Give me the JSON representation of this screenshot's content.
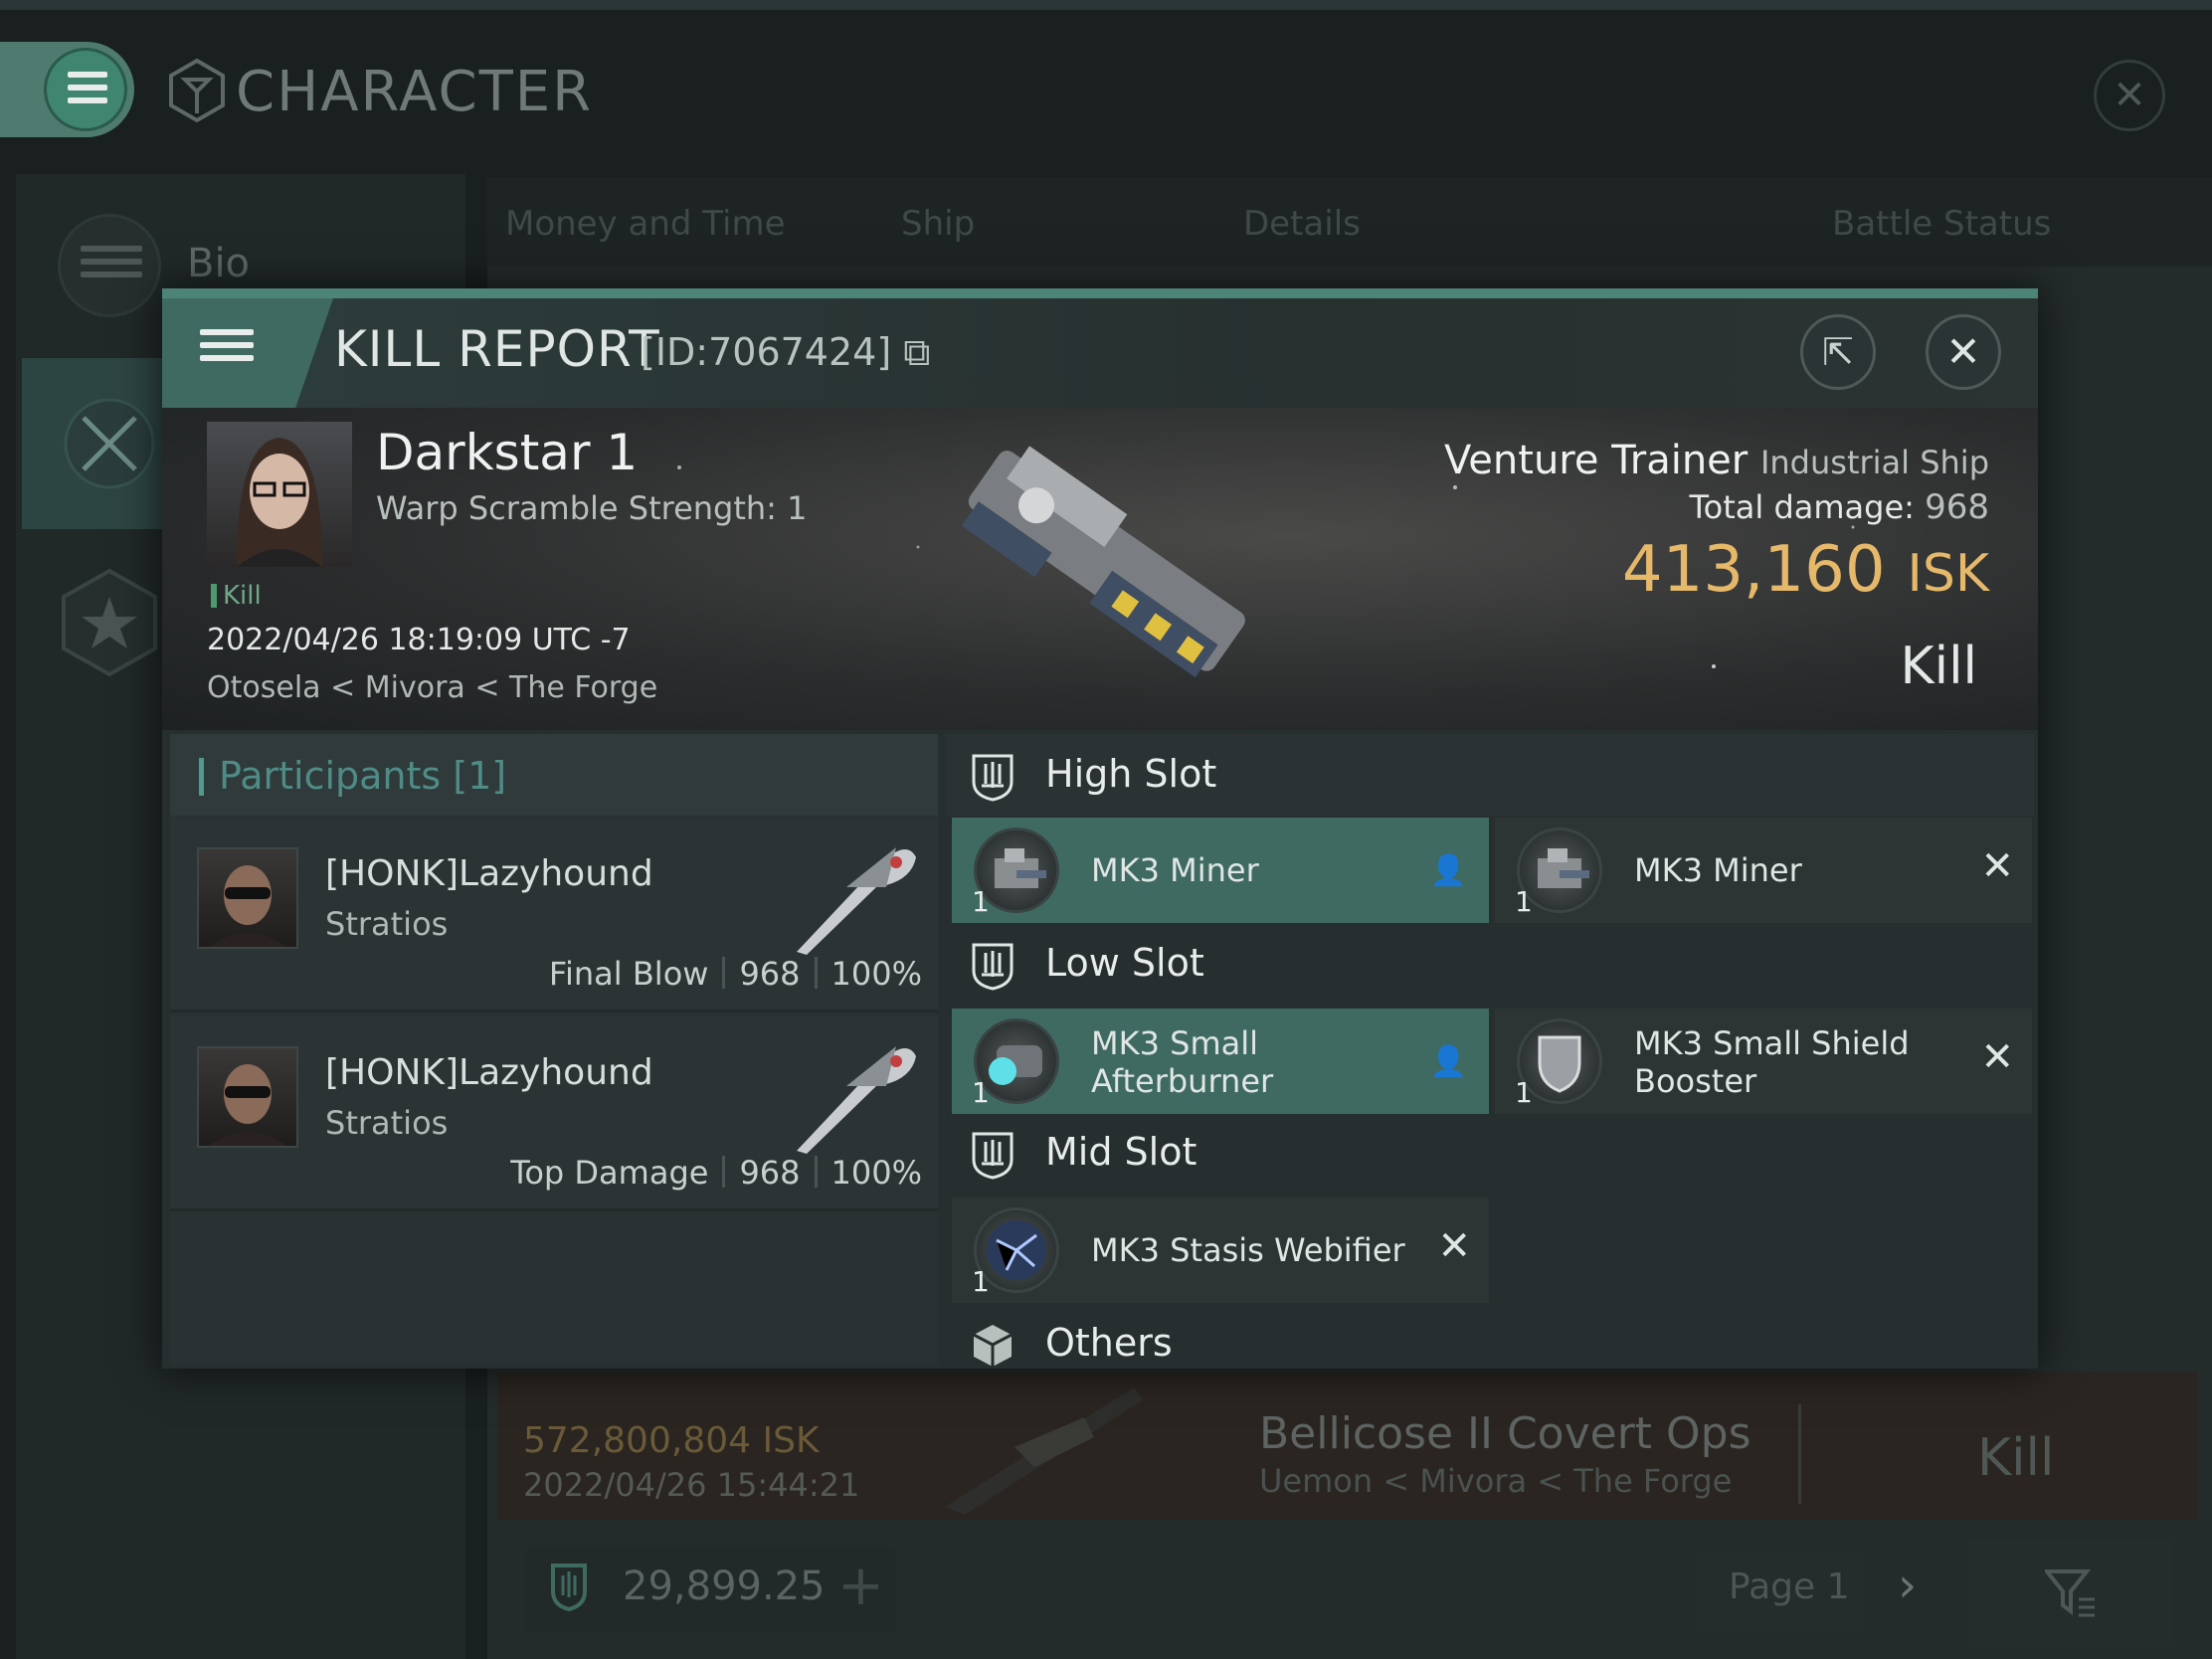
{
  "background": {
    "window_title": "CHARACTER",
    "sidebar_bio": "Bio",
    "tabs": [
      "Money and Time",
      "Ship",
      "Details",
      "Battle Status"
    ],
    "kill_row": {
      "isk": "572,800,804  ISK",
      "date": "2022/04/26  15:44:21",
      "ship": "Bellicose II Covert Ops",
      "location": "Uemon < Mivora < The Forge",
      "result": "Kill"
    },
    "wallet": "29,899.25",
    "page": "Page 1"
  },
  "modal": {
    "title": "KILL REPORT",
    "id": "[ID:7067424]",
    "victim": {
      "name": "Darkstar 1",
      "warp_scramble": "Warp Scramble Strength: 1",
      "tag": "Kill",
      "datetime": "2022/04/26 18:19:09 UTC -7",
      "location": "Otosela < Mivora < The Forge"
    },
    "ship": {
      "name": "Venture Trainer",
      "class": "Industrial Ship",
      "total_damage_label": "Total damage:",
      "total_damage": "968",
      "isk_value": "413,160",
      "isk_unit": "ISK",
      "result": "Kill"
    },
    "participants": {
      "title": "Participants [1]",
      "rows": [
        {
          "name": "[HONK]Lazyhound",
          "ship": "Stratios",
          "label": "Final Blow",
          "damage": "968",
          "percent": "100%"
        },
        {
          "name": "[HONK]Lazyhound",
          "ship": "Stratios",
          "label": "Top Damage",
          "damage": "968",
          "percent": "100%"
        }
      ]
    },
    "slots": {
      "high": {
        "title": "High Slot",
        "modules": [
          {
            "name": "MK3 Miner",
            "qty": "1",
            "state": "fitted"
          },
          {
            "name": "MK3 Miner",
            "qty": "1",
            "state": "destroyed"
          }
        ]
      },
      "low": {
        "title": "Low Slot",
        "modules": [
          {
            "name_line1": "MK3 Small",
            "name_line2": "Afterburner",
            "qty": "1",
            "state": "fitted"
          },
          {
            "name_line1": "MK3 Small Shield",
            "name_line2": "Booster",
            "qty": "1",
            "state": "destroyed"
          }
        ]
      },
      "mid": {
        "title": "Mid Slot",
        "modules": [
          {
            "name": "MK3 Stasis Webifier",
            "qty": "1",
            "state": "destroyed"
          }
        ]
      },
      "others": {
        "title": "Others"
      }
    }
  },
  "colors": {
    "accent": "#4c8478",
    "fitted": "#3f6a62",
    "isk": "#e5b86a",
    "kill_tag": "#6fa88a"
  }
}
